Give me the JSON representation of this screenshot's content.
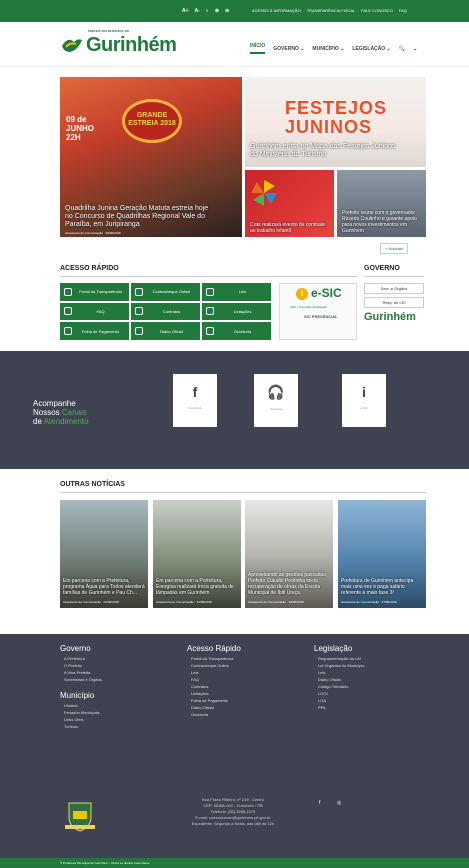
{
  "topbar": {
    "accessibility": [
      "A+",
      "A-",
      "◐",
      "⊕",
      "⊖"
    ],
    "links": [
      "ACESSO À INFORMAÇÃO",
      "TRANSPARÊNCIA FISCAL",
      "FALE CONOSCO",
      "FAQ"
    ]
  },
  "header": {
    "logo_sub": "PREFEITURA MUNICIPAL DE",
    "logo_name": "Gurinhém",
    "nav": [
      "INÍCIO",
      "GOVERNO ⌄",
      "MUNICÍPIO ⌄",
      "LEGISLAÇÃO ⌄",
      "🔍",
      "⌄"
    ]
  },
  "slider": [
    {
      "caption": "Quadrilha Junina Geração Matuta estreia hoje no Concurso de Quadrilhas Regional Vale do Paraíba, em Juripiranga",
      "meta": "Assessoria de Comunicação · 09/06/2018",
      "banner": "GRANDE ESTREIA 2018",
      "date": "09 de JUNHO 22H"
    },
    {
      "caption": "Gurinhém entra no Mapa dos Festejos Juninos do Ministério do Turismo",
      "banner": "FESTEJOS JUNINOS"
    },
    {
      "caption": "Cras realizará evento de combate ao trabalho infantil"
    },
    {
      "caption": "Prefeito reúne com o governador Ricardo Coutinho e garante apoio para novos investimentos em Gurinhém"
    }
  ],
  "more_news": "+ Notícias",
  "acesso_rapido": {
    "title": "ACESSO RÁPIDO",
    "items": [
      "Portal da Transparência",
      "Contracheque Online",
      "LeIs",
      "FAQ",
      "Contratos",
      "Licitações",
      "Folha de Pagamento",
      "Diário Oficial",
      "Ouvidoria"
    ]
  },
  "esic": {
    "title": "e-SIC",
    "link": "Abrir / Consultar Solicitação",
    "sub": "SIC PRESENCIAL"
  },
  "governo": {
    "title": "GOVERNO",
    "items": [
      "Secr. e Órgãos",
      "Resp. de LEI"
    ],
    "logo": "Gurinhém"
  },
  "canais": {
    "line1": "Acompanhe",
    "line2a": "Nossos ",
    "line2b": "Canais",
    "line3a": "de ",
    "line3b": "Atendimento",
    "cards": [
      {
        "icon": "f",
        "label": "Facebook"
      },
      {
        "icon": "🎧",
        "label": "Ouvidoria"
      },
      {
        "icon": "i",
        "label": "e-SIC"
      }
    ]
  },
  "outras": {
    "title": "OUTRAS NOTÍCIAS",
    "items": [
      {
        "caption": "Em parceria com a Prefeitura, programa Água para Todos atenderá famílias de Gurinhém e Pau Ch...",
        "meta": "Assessoria de Comunicação · 02/06/2018"
      },
      {
        "caption": "Em parceria com a Prefeitura, Energisa realizará troca gratuita de lâmpadas em Gurinhém",
        "meta": "Assessoria de Comunicação · 31/05/2018"
      },
      {
        "caption": "Aproveitando as gestões passadas, Prefeito Cláudio Pedrinha inicia recuperação de obras da Escola Municipal de Ibiti Ureça",
        "meta": "Assessoria de Comunicação · 18/05/2018"
      },
      {
        "caption": "Prefeitura de Gurinhém antecipa mais uma vez e paga salário referente à maio fase 3!",
        "meta": "Assessoria de Comunicação · 17/05/2018"
      }
    ]
  },
  "footer": {
    "governo": {
      "title": "Governo",
      "items": [
        "A Prefeitura",
        "O Prefeito",
        "A Vice-Prefeita",
        "Secretarias e Órgãos"
      ]
    },
    "municipio": {
      "title": "Município",
      "items": [
        "História",
        "Feriados Municipais",
        "Links Úteis",
        "Turismo"
      ]
    },
    "acesso": {
      "title": "Acesso Rápido",
      "items": [
        "Portal da Transparência",
        "Contracheque Online",
        "LeIs",
        "FAQ",
        "Contratos",
        "Licitações",
        "Folha de Pagamento",
        "Diário Oficial",
        "Ouvidoria"
      ]
    },
    "legislacao": {
      "title": "Legislação",
      "items": [
        "Regulamentação da LAI",
        "Lei Orgânica do Município",
        "Leis",
        "Diário Oficial",
        "Código Tributário",
        "LOOI",
        "LOA",
        "PPA"
      ]
    },
    "address": [
      "Rua Flávio Ribeiro, nº 219 - Centro",
      "CEP: 58356-000 - Gurinhém / PB",
      "Telefone: (83) 3285-1079",
      "E-mail: comunicacao@gurinhem.pb.gov.br",
      "Expediente: Segunda a Sexta, das 08h às 12h"
    ],
    "social": [
      "f",
      "◎"
    ],
    "bottom": "© Prefeitura Municipal de Gurinhém – Todos os direitos reservados."
  }
}
